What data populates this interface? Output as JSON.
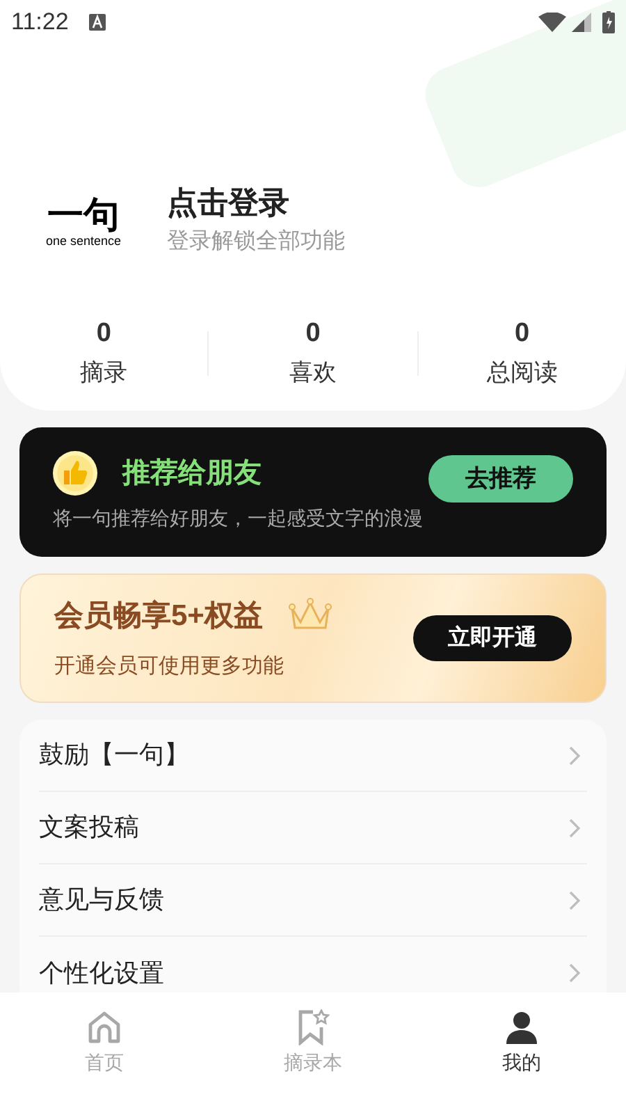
{
  "status_bar": {
    "time": "11:22"
  },
  "profile": {
    "logo_text": "一句",
    "logo_subtitle": "one sentence",
    "title": "点击登录",
    "subtitle": "登录解锁全部功能"
  },
  "stats": [
    {
      "value": "0",
      "label": "摘录"
    },
    {
      "value": "0",
      "label": "喜欢"
    },
    {
      "value": "0",
      "label": "总阅读"
    }
  ],
  "recommend_card": {
    "title": "推荐给朋友",
    "text": "将一句推荐给好朋友，一起感受文字的浪漫",
    "button": "去推荐"
  },
  "member_card": {
    "title": "会员畅享5+权益",
    "text": "开通会员可使用更多功能",
    "button": "立即开通"
  },
  "menu": [
    {
      "label": "鼓励【一句】"
    },
    {
      "label": "文案投稿"
    },
    {
      "label": "意见与反馈"
    },
    {
      "label": "个性化设置"
    }
  ],
  "tab_bar": [
    {
      "kind": "home",
      "label": "首页",
      "selected": false
    },
    {
      "kind": "bookmark",
      "label": "摘录本",
      "selected": false
    },
    {
      "kind": "person",
      "label": "我的",
      "selected": true
    }
  ]
}
